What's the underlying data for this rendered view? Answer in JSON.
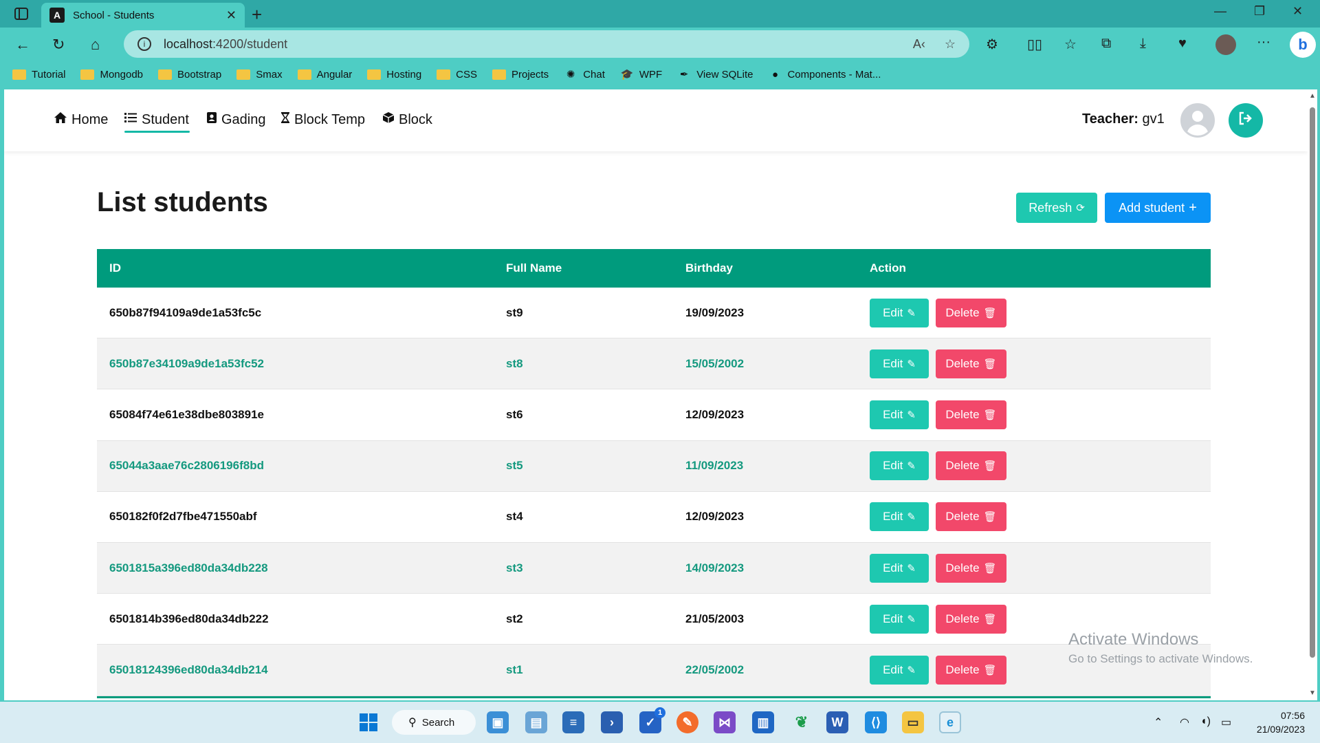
{
  "browser": {
    "tab_title": "School - Students",
    "tab_favicon": "A",
    "url_host": "localhost",
    "url_rest": ":4200/student",
    "bookmarks": [
      {
        "label": "Tutorial",
        "icon": "folder-icon"
      },
      {
        "label": "Mongodb",
        "icon": "folder-icon"
      },
      {
        "label": "Bootstrap",
        "icon": "folder-icon"
      },
      {
        "label": "Smax",
        "icon": "folder-icon"
      },
      {
        "label": "Angular",
        "icon": "folder-icon"
      },
      {
        "label": "Hosting",
        "icon": "folder-icon"
      },
      {
        "label": "CSS",
        "icon": "folder-icon"
      },
      {
        "label": "Projects",
        "icon": "folder-icon"
      },
      {
        "label": "Chat",
        "icon": "openai-icon"
      },
      {
        "label": "WPF",
        "icon": "graduation-cap-icon"
      },
      {
        "label": "View SQLite",
        "icon": "feather-icon"
      },
      {
        "label": "Components - Mat...",
        "icon": "github-icon"
      }
    ]
  },
  "nav": {
    "items": [
      {
        "label": "Home",
        "icon": "home-icon"
      },
      {
        "label": "Student",
        "icon": "list-icon",
        "active": true
      },
      {
        "label": "Gading",
        "icon": "contact-book-icon"
      },
      {
        "label": "Block Temp",
        "icon": "hourglass-icon"
      },
      {
        "label": "Block",
        "icon": "cube-icon"
      }
    ],
    "teacher_label": "Teacher:",
    "teacher_name": "gv1"
  },
  "page": {
    "title": "List students",
    "refresh_label": "Refresh",
    "add_label": "Add student"
  },
  "table": {
    "headers": [
      "ID",
      "Full Name",
      "Birthday",
      "Action"
    ],
    "edit_label": "Edit",
    "delete_label": "Delete",
    "rows": [
      {
        "id": "650b87f94109a9de1a53fc5c",
        "name": "st9",
        "birthday": "19/09/2023"
      },
      {
        "id": "650b87e34109a9de1a53fc52",
        "name": "st8",
        "birthday": "15/05/2002"
      },
      {
        "id": "65084f74e61e38dbe803891e",
        "name": "st6",
        "birthday": "12/09/2023"
      },
      {
        "id": "65044a3aae76c2806196f8bd",
        "name": "st5",
        "birthday": "11/09/2023"
      },
      {
        "id": "650182f0f2d7fbe471550abf",
        "name": "st4",
        "birthday": "12/09/2023"
      },
      {
        "id": "6501815a396ed80da34db228",
        "name": "st3",
        "birthday": "14/09/2023"
      },
      {
        "id": "6501814b396ed80da34db222",
        "name": "st2",
        "birthday": "21/05/2003"
      },
      {
        "id": "65018124396ed80da34db214",
        "name": "st1",
        "birthday": "22/05/2002"
      }
    ]
  },
  "watermark": {
    "line1": "Activate Windows",
    "line2": "Go to Settings to activate Windows."
  },
  "taskbar": {
    "search_label": "Search",
    "badge_count": "1",
    "time": "07:56",
    "date": "21/09/2023"
  },
  "colors": {
    "accent_teal": "#14b8a6",
    "table_header": "#009b7d",
    "add_blue": "#0b93f5",
    "delete_red": "#f2486a"
  }
}
